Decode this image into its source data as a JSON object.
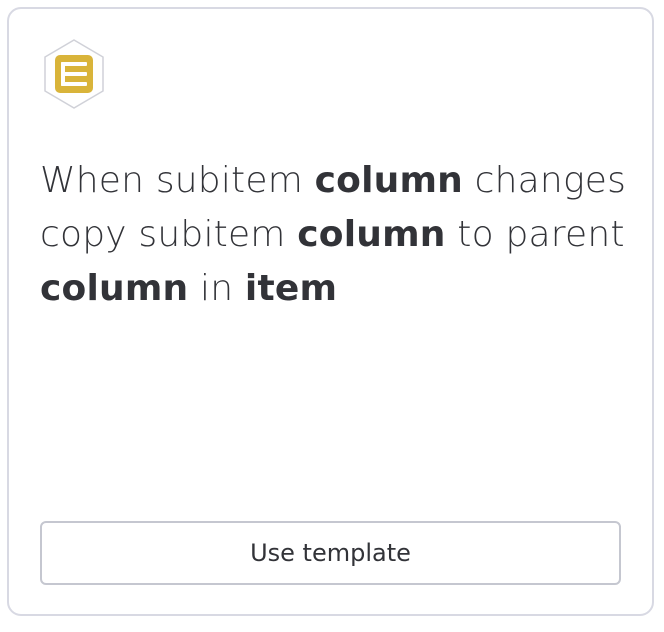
{
  "card": {
    "icon": "subitems-app-icon",
    "icon_color": "#d9b43a",
    "recipe": {
      "w1": "When subitem ",
      "t1": "column",
      "w2": " changes copy subitem ",
      "t2": "column",
      "w3": " to parent ",
      "t3": "column",
      "w4": " in ",
      "t4": "item"
    },
    "button_label": "Use template"
  }
}
